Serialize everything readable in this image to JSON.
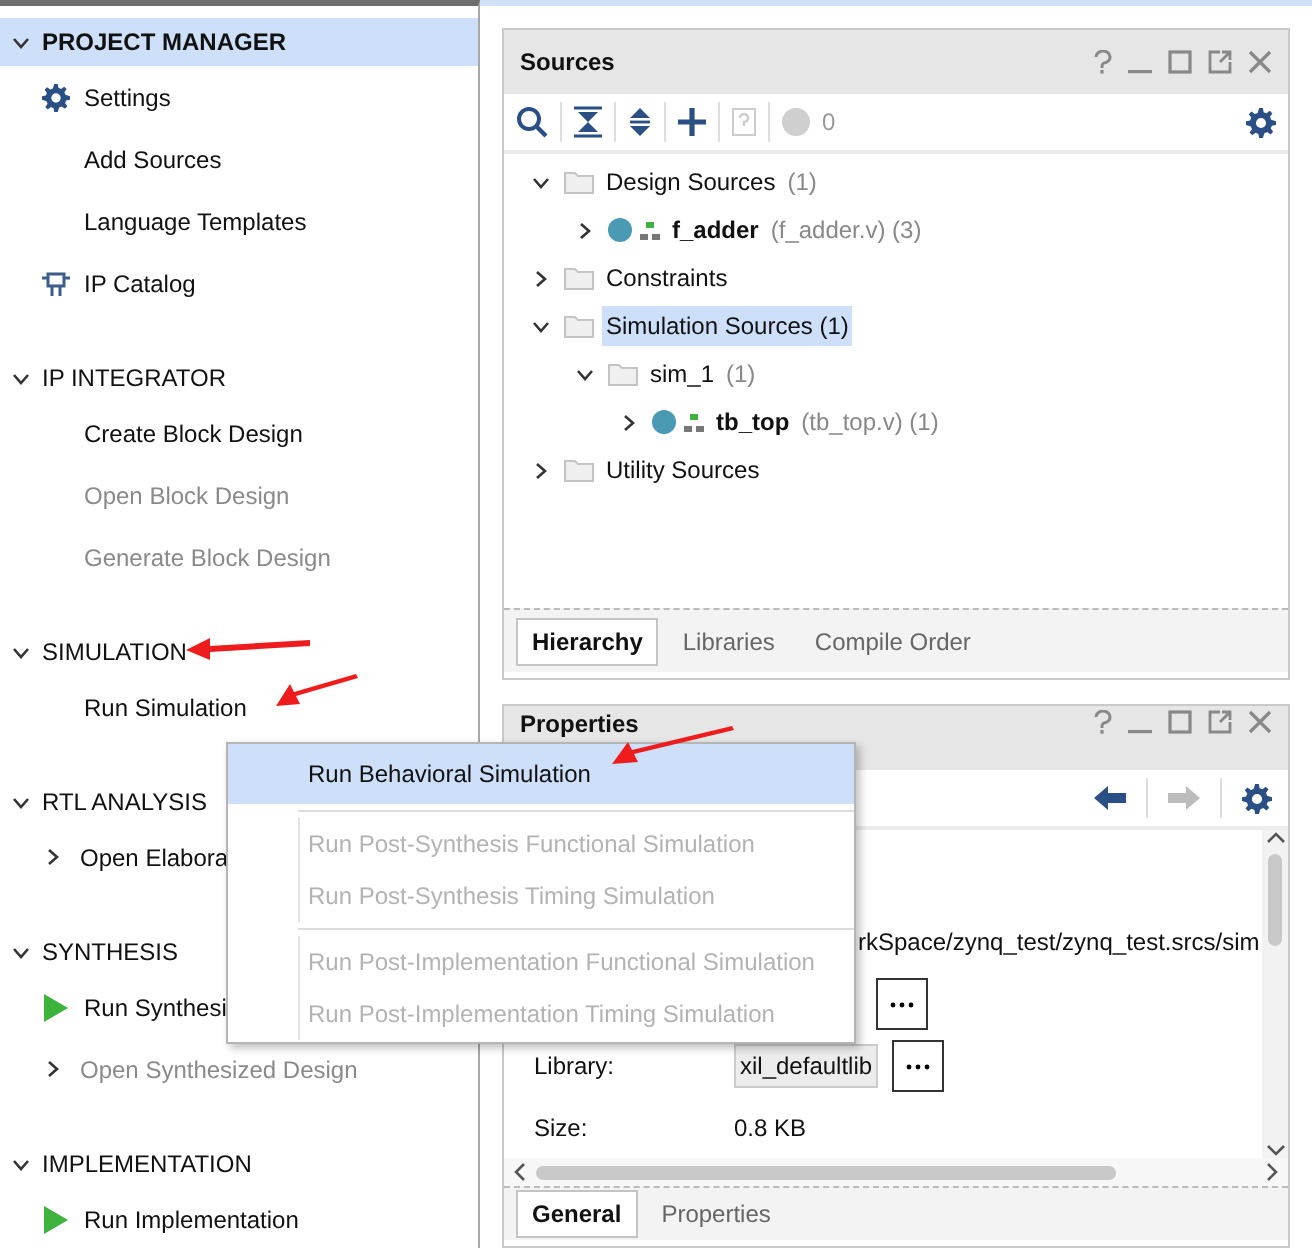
{
  "flow_navigator": {
    "sections": [
      {
        "title": "PROJECT MANAGER",
        "expanded": true,
        "selected": true,
        "items": [
          {
            "label": "Settings",
            "kind": "settings",
            "disabled": false
          },
          {
            "label": "Add Sources",
            "kind": "plain",
            "disabled": false
          },
          {
            "label": "Language Templates",
            "kind": "plain",
            "disabled": false
          },
          {
            "label": "IP Catalog",
            "kind": "catalog",
            "disabled": false
          }
        ]
      },
      {
        "title": "IP INTEGRATOR",
        "expanded": true,
        "selected": false,
        "items": [
          {
            "label": "Create Block Design",
            "kind": "plain",
            "disabled": false
          },
          {
            "label": "Open Block Design",
            "kind": "plain",
            "disabled": true
          },
          {
            "label": "Generate Block Design",
            "kind": "plain",
            "disabled": true
          }
        ]
      },
      {
        "title": "SIMULATION",
        "expanded": true,
        "selected": false,
        "items": [
          {
            "label": "Run Simulation",
            "kind": "plain",
            "disabled": false
          }
        ]
      },
      {
        "title": "RTL ANALYSIS",
        "expanded": true,
        "selected": false,
        "items": [
          {
            "label": "Open Elabora",
            "kind": "expandable",
            "disabled": false,
            "expanded": false
          }
        ]
      },
      {
        "title": "SYNTHESIS",
        "expanded": true,
        "selected": false,
        "items": [
          {
            "label": "Run Synthesi",
            "kind": "run",
            "disabled": false
          },
          {
            "label": "Open Synthesized Design",
            "kind": "expandable",
            "disabled": true,
            "expanded": false
          }
        ]
      },
      {
        "title": "IMPLEMENTATION",
        "expanded": true,
        "selected": false,
        "items": [
          {
            "label": "Run Implementation",
            "kind": "run",
            "disabled": false
          }
        ]
      }
    ]
  },
  "sources": {
    "title": "Sources",
    "issue_count": "0",
    "tree": [
      {
        "label": "Design Sources",
        "detail": "(1)",
        "kind": "folder",
        "expanded": true,
        "selected": false,
        "children": [
          {
            "label": "f_adder",
            "detail": "(f_adder.v) (3)",
            "kind": "module",
            "expanded": false,
            "selected": false
          }
        ]
      },
      {
        "label": "Constraints",
        "kind": "folder",
        "expanded": false,
        "selected": false
      },
      {
        "label": "Simulation Sources (1)",
        "kind": "folder",
        "expanded": true,
        "selected": true,
        "children": [
          {
            "label": "sim_1",
            "detail": "(1)",
            "kind": "folder",
            "expanded": true,
            "selected": false,
            "children": [
              {
                "label": "tb_top",
                "detail": "(tb_top.v) (1)",
                "kind": "module",
                "expanded": false,
                "selected": false
              }
            ]
          }
        ]
      },
      {
        "label": "Utility Sources",
        "kind": "folder",
        "expanded": false,
        "selected": false
      }
    ],
    "tabs": [
      {
        "label": "Hierarchy",
        "selected": true
      },
      {
        "label": "Libraries",
        "selected": false
      },
      {
        "label": "Compile Order",
        "selected": false
      }
    ]
  },
  "properties": {
    "title": "Properties",
    "path": "rkSpace/zynq_test/zynq_test.srcs/sim",
    "fields": [
      {
        "kind": "button_only"
      },
      {
        "kind": "field",
        "label": "Library:",
        "value": "xil_defaultlib"
      },
      {
        "kind": "text",
        "label": "Size:",
        "value": "0.8 KB"
      }
    ],
    "tabs": [
      {
        "label": "General",
        "selected": true
      },
      {
        "label": "Properties",
        "selected": false
      }
    ]
  },
  "context_menu": {
    "items": [
      {
        "kind": "item",
        "label": "Run Behavioral Simulation",
        "disabled": false,
        "selected": true
      },
      {
        "kind": "separator"
      },
      {
        "kind": "item",
        "label": "Run Post-Synthesis Functional Simulation",
        "disabled": true,
        "selected": false
      },
      {
        "kind": "item",
        "label": "Run Post-Synthesis Timing Simulation",
        "disabled": true,
        "selected": false
      },
      {
        "kind": "separator"
      },
      {
        "kind": "item",
        "label": "Run Post-Implementation Functional Simulation",
        "disabled": true,
        "selected": false
      },
      {
        "kind": "item",
        "label": "Run Post-Implementation Timing Simulation",
        "disabled": true,
        "selected": false
      }
    ]
  }
}
